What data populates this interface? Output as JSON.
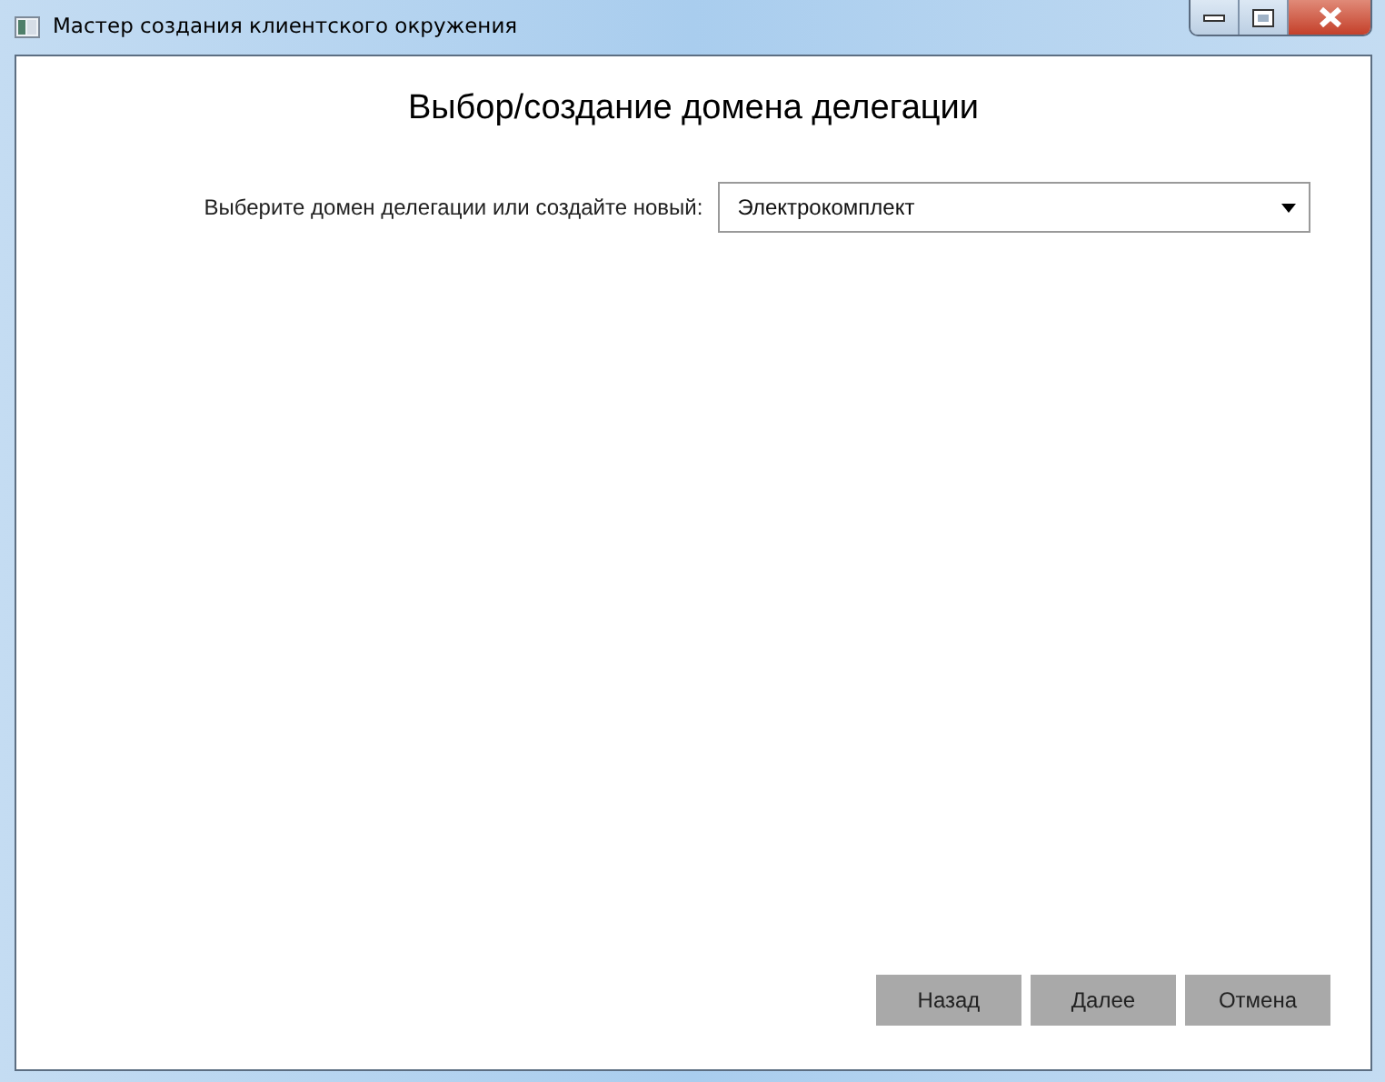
{
  "window": {
    "title": "Мастер создания клиентского окружения"
  },
  "heading": "Выбор/создание домена делегации",
  "domain_field": {
    "label": "Выберите домен делегации или создайте новый:",
    "value": "Электрокомплект"
  },
  "buttons": [
    {
      "label": "Назад"
    },
    {
      "label": "Далее"
    },
    {
      "label": "Отмена"
    }
  ]
}
